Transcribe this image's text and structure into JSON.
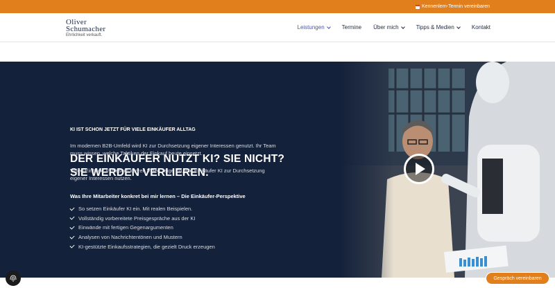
{
  "topbar": {
    "link_label": "Kennenlern-Termin vereinbaren",
    "icon": "calendar-icon"
  },
  "logo": {
    "line1": "Oliver",
    "line2": "Schumacher",
    "tagline": "Ehrlichkeit verkauft."
  },
  "nav": {
    "items": [
      {
        "label": "Leistungen",
        "dropdown": true
      },
      {
        "label": "Termine",
        "dropdown": false
      },
      {
        "label": "Über mich",
        "dropdown": true
      },
      {
        "label": "Tipps & Medien",
        "dropdown": true
      },
      {
        "label": "Kontakt",
        "dropdown": false
      }
    ]
  },
  "hero": {
    "title": "DER EINKÄUFER NUTZT KI? SIE NICHT? SIE WERDEN VERLIEREN.",
    "kicker": "KI IST SCHON JETZT FÜR VIELE EINKÄUFER ALLTAG",
    "paragraph1": "Im modernen B2B-Umfeld wird KI zur Durchsetzung eigener Interessen genutzt. Ihr Team muss wissen, welche Taktiken der Einkauf heute einsetzt.",
    "paragraph2": "Video-Einblick: In diesem kurzen Video zeige ich, wie Einkäufer KI zur Durchsetzung eigener Interessen nutzen.",
    "subheading": "Was Ihre Mitarbeiter konkret bei mir lernen – Die Einkäufer-Perspektive",
    "checklist": [
      "So setzen Einkäufer KI ein. Mit realen Beispielen.",
      "Vollständig vorbereitete Preisgespräche aus der KI",
      "Einwände mit fertigen Gegenargumenten",
      "Analysen von Nachrichtentönen und Mustern",
      "KI-gestützte Einkaufsstrategien, die gezielt Druck erzeugen"
    ]
  },
  "cta_button": {
    "label": "Gespräch vereinbaren"
  },
  "colors": {
    "accent": "#e07f1c",
    "hero_bg": "#14213a",
    "nav_text": "#1e2a44",
    "nav_active": "#4a56a6"
  }
}
